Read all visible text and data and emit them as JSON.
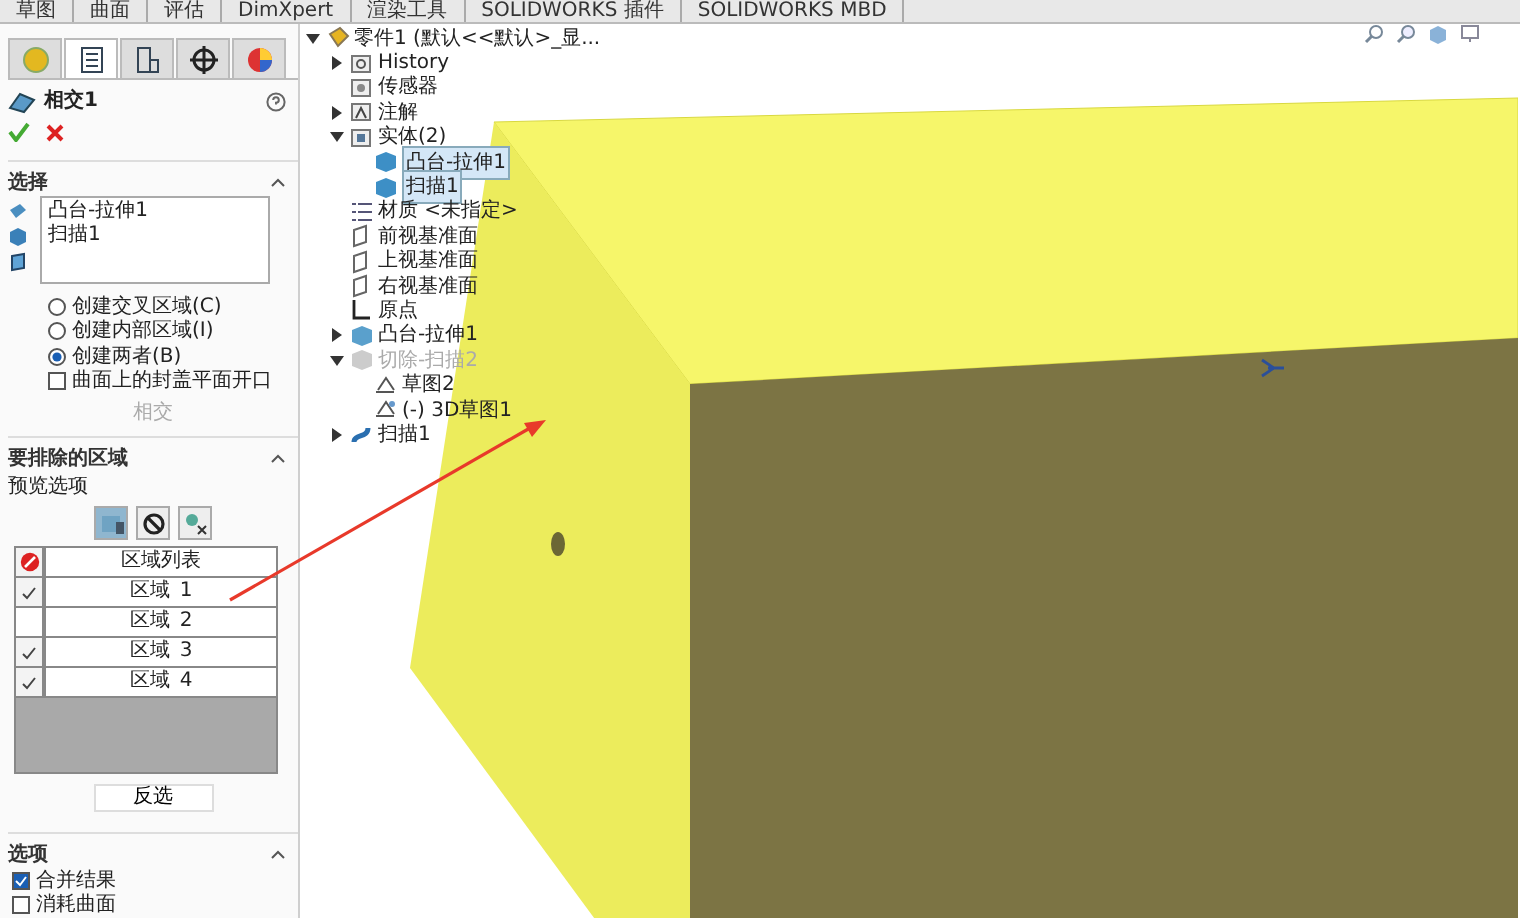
{
  "command_tabs": [
    {
      "label": "草图"
    },
    {
      "label": "曲面"
    },
    {
      "label": "评估"
    },
    {
      "label": "DimXpert"
    },
    {
      "label": "渲染工具"
    },
    {
      "label": "SOLIDWORKS 插件"
    },
    {
      "label": "SOLIDWORKS MBD"
    }
  ],
  "panel_tabs": [
    {
      "kind": "feature",
      "selected": false
    },
    {
      "kind": "tree",
      "selected": true
    },
    {
      "kind": "config",
      "selected": false
    },
    {
      "kind": "dim",
      "selected": false
    },
    {
      "kind": "display",
      "selected": false
    }
  ],
  "property_manager": {
    "title": "相交1",
    "selection": {
      "heading": "选择",
      "expanded": true,
      "items": [
        "凸台-拉伸1",
        "扫描1"
      ],
      "options": [
        {
          "kind": "radio",
          "label": "创建交叉区域(C)",
          "checked": false
        },
        {
          "kind": "radio",
          "label": "创建内部区域(I)",
          "checked": false
        },
        {
          "kind": "radio",
          "label": "创建两者(B)",
          "checked": true
        },
        {
          "kind": "checkbox",
          "label": "曲面上的封盖平面开口",
          "checked": false
        }
      ],
      "button": {
        "label": "相交",
        "disabled": true
      }
    },
    "exclude": {
      "heading": "要排除的区域",
      "expanded": true,
      "preview_label": "预览选项",
      "preview_buttons": [
        {
          "kind": "include",
          "selected": true
        },
        {
          "kind": "exclude",
          "selected": false
        },
        {
          "kind": "both",
          "selected": false
        }
      ],
      "column": "区域列表",
      "rows": [
        {
          "name": "区域",
          "number": "1",
          "checked": true
        },
        {
          "name": "区域",
          "number": "2",
          "checked": false
        },
        {
          "name": "区域",
          "number": "3",
          "checked": true
        },
        {
          "name": "区域",
          "number": "4",
          "checked": true
        }
      ],
      "button": "反选"
    },
    "options": {
      "heading": "选项",
      "expanded": true,
      "items": [
        {
          "label": "合并结果",
          "checked": true
        },
        {
          "label": "消耗曲面",
          "checked": false
        }
      ]
    }
  },
  "tree": {
    "root": "零件1 (默认<<默认>_显...",
    "items": [
      {
        "kind": "history",
        "label": "History",
        "expanded": false,
        "disabled": false
      },
      {
        "kind": "sensor",
        "label": "传感器",
        "disabled": false
      },
      {
        "kind": "annotation",
        "label": "注解",
        "expanded": false,
        "disabled": false
      },
      {
        "kind": "solids",
        "label": "实体(2)",
        "expanded": true,
        "disabled": false,
        "children": [
          {
            "kind": "body",
            "label": "凸台-拉伸1",
            "selected": true,
            "disabled": false
          },
          {
            "kind": "body",
            "label": "扫描1",
            "selected": true,
            "disabled": false
          }
        ]
      },
      {
        "kind": "material",
        "label": "材质 <未指定>",
        "disabled": false
      },
      {
        "kind": "plane",
        "label": "前视基准面",
        "disabled": false
      },
      {
        "kind": "plane",
        "label": "上视基准面",
        "disabled": false
      },
      {
        "kind": "plane",
        "label": "右视基准面",
        "disabled": false
      },
      {
        "kind": "origin",
        "label": "原点",
        "disabled": false
      },
      {
        "kind": "feature",
        "label": "凸台-拉伸1",
        "expanded": false,
        "disabled": false
      },
      {
        "kind": "cut",
        "label": "切除-扫描2",
        "expanded": true,
        "disabled": true,
        "children": [
          {
            "kind": "sketch",
            "label": "草图2",
            "disabled": false
          },
          {
            "kind": "sketch3d",
            "label": "(-) 3D草图1",
            "disabled": false
          }
        ]
      },
      {
        "kind": "sweep",
        "label": "扫描1",
        "expanded": false,
        "disabled": false
      }
    ]
  }
}
